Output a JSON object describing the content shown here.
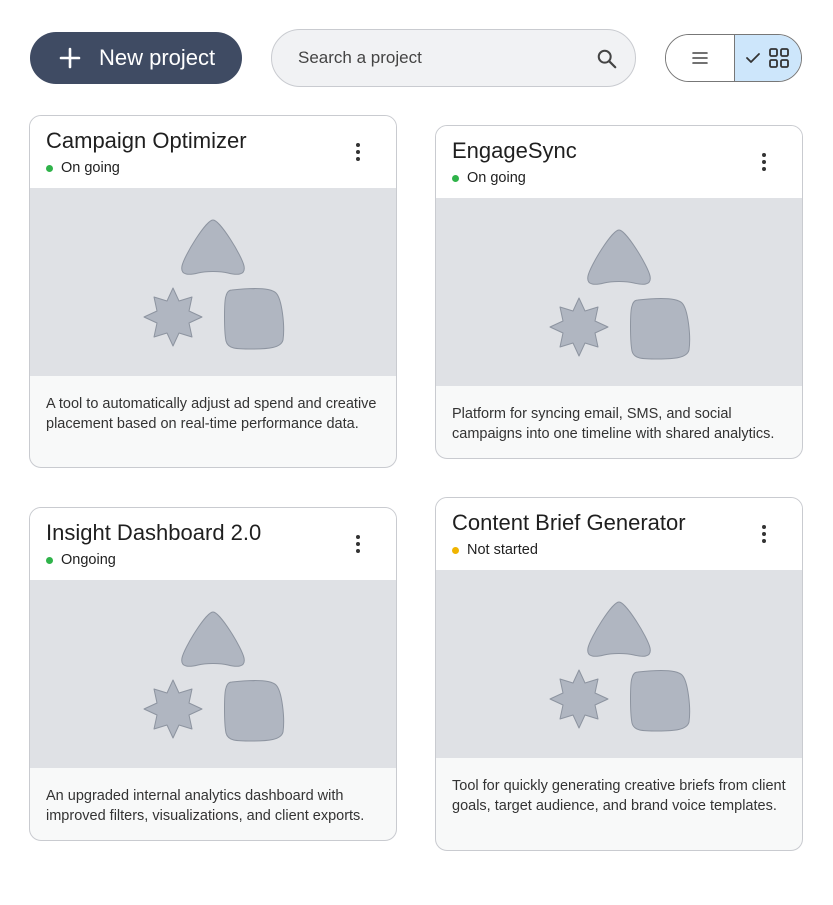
{
  "toolbar": {
    "new_project_label": "New project",
    "search_placeholder": "Search a project",
    "view_toggle": {
      "options": [
        "list",
        "grid"
      ],
      "selected": "grid"
    }
  },
  "colors": {
    "primary_button": "#3f4b63",
    "status_green": "#2fb34a",
    "status_amber": "#f0b400",
    "toggle_selected": "#cde6fb"
  },
  "projects": [
    {
      "title": "Campaign Optimizer",
      "status": "On going",
      "status_color": "#2fb34a",
      "description": "A tool to automatically adjust ad spend and creative placement based on real-time performance data."
    },
    {
      "title": "EngageSync",
      "status": "On going",
      "status_color": "#2fb34a",
      "description": "Platform for syncing email, SMS, and social campaigns into one timeline with shared analytics."
    },
    {
      "title": "Insight Dashboard 2.0",
      "status": "Ongoing",
      "status_color": "#2fb34a",
      "description": "An upgraded internal analytics dashboard with improved filters, visualizations, and client exports."
    },
    {
      "title": "Content Brief Generator",
      "status": "Not started",
      "status_color": "#f0b400",
      "description": "Tool for quickly generating creative briefs from client goals, target audience, and brand voice templates."
    }
  ]
}
